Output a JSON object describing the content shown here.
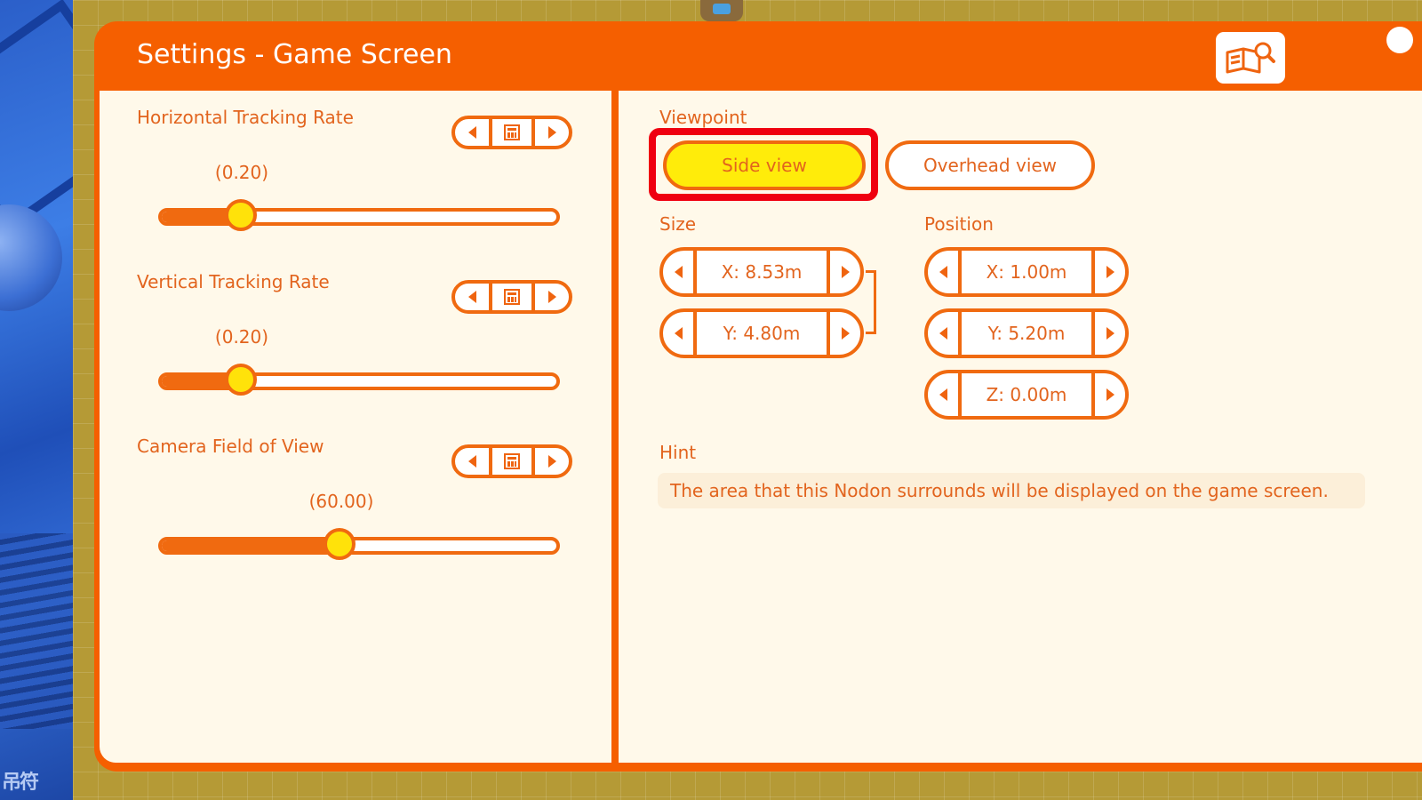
{
  "window": {
    "title": "Settings - Game Screen"
  },
  "help": {
    "icon": "book-magnifier-icon"
  },
  "left": {
    "settings": [
      {
        "label": "Horizontal Tracking Rate",
        "value_text": "(0.20)",
        "level": 0.2
      },
      {
        "label": "Vertical Tracking Rate",
        "value_text": "(0.20)",
        "level": 0.2
      },
      {
        "label": "Camera Field of View",
        "value_text": "(60.00)",
        "level": 0.45
      }
    ]
  },
  "viewpoint": {
    "label": "Viewpoint",
    "options": [
      "Side view",
      "Overhead view"
    ],
    "selected": "Side view"
  },
  "size": {
    "label": "Size",
    "x": "X: 8.53m",
    "y": "Y: 4.80m"
  },
  "position": {
    "label": "Position",
    "x": "X: 1.00m",
    "y": "Y: 5.20m",
    "z": "Z: 0.00m"
  },
  "hint": {
    "label": "Hint",
    "text": "The area that this Nodon surrounds will be displayed on the game screen."
  },
  "colors": {
    "accent": "#f55f00",
    "panel_bg": "#fff9ea",
    "selected": "#ffec0a",
    "highlight": "#ef0010",
    "text": "#e2641e"
  }
}
